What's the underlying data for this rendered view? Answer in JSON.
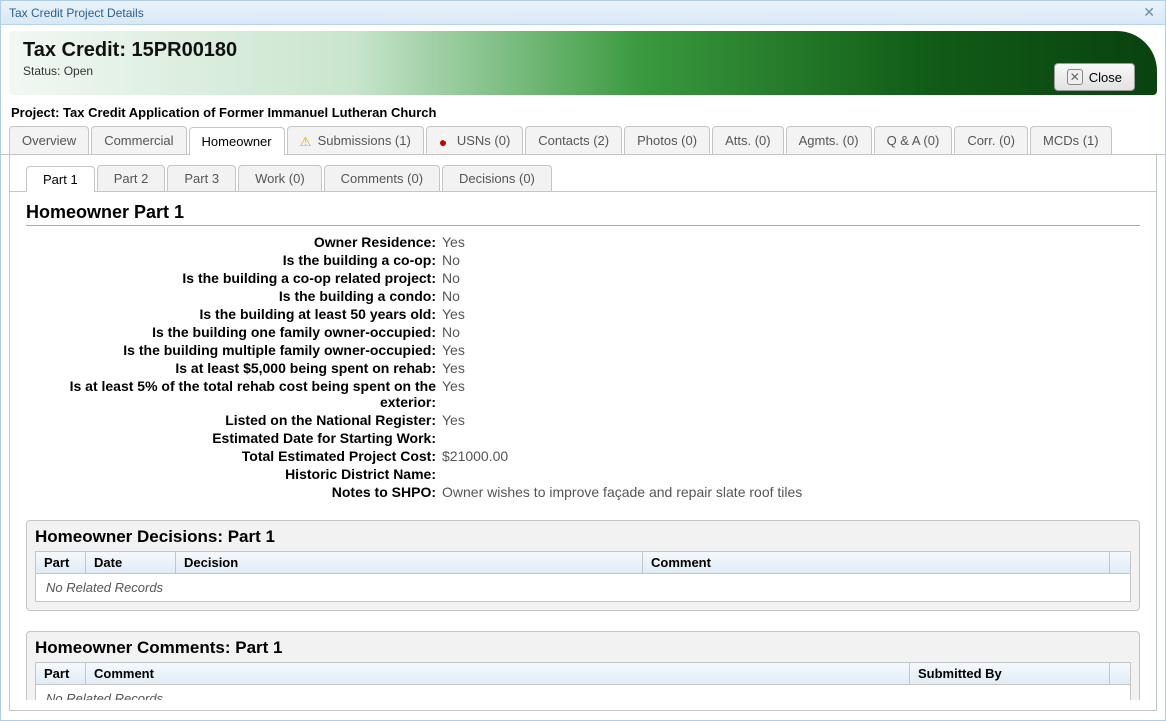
{
  "window": {
    "title": "Tax Credit Project Details"
  },
  "header": {
    "title": "Tax Credit: 15PR00180",
    "status_label": "Status:",
    "status_value": "Open",
    "close_label": "Close"
  },
  "project": {
    "label": "Project:",
    "name": "Tax Credit Application of Former Immanuel Lutheran Church"
  },
  "tabs": [
    {
      "label": "Overview"
    },
    {
      "label": "Commercial"
    },
    {
      "label": "Homeowner",
      "active": true
    },
    {
      "label": "Submissions (1)",
      "icon": "warn"
    },
    {
      "label": "USNs (0)",
      "icon": "error"
    },
    {
      "label": "Contacts (2)"
    },
    {
      "label": "Photos (0)"
    },
    {
      "label": "Atts. (0)"
    },
    {
      "label": "Agmts. (0)"
    },
    {
      "label": "Q & A (0)"
    },
    {
      "label": "Corr. (0)"
    },
    {
      "label": "MCDs (1)"
    }
  ],
  "subtabs": [
    {
      "label": "Part 1",
      "active": true
    },
    {
      "label": "Part 2"
    },
    {
      "label": "Part 3"
    },
    {
      "label": "Work (0)"
    },
    {
      "label": "Comments (0)"
    },
    {
      "label": "Decisions (0)"
    }
  ],
  "part1": {
    "title": "Homeowner Part 1",
    "fields": [
      {
        "label": "Owner Residence:",
        "value": "Yes"
      },
      {
        "label": "Is the building a co-op:",
        "value": "No"
      },
      {
        "label": "Is the building a co-op related project:",
        "value": "No"
      },
      {
        "label": "Is the building a condo:",
        "value": "No"
      },
      {
        "label": "Is the building at least 50 years old:",
        "value": "Yes"
      },
      {
        "label": "Is the building one family owner-occupied:",
        "value": "No"
      },
      {
        "label": "Is the building multiple family owner-occupied:",
        "value": "Yes"
      },
      {
        "label": "Is at least $5,000 being spent on rehab:",
        "value": "Yes"
      },
      {
        "label": "Is at least 5% of the total rehab cost being spent on the exterior:",
        "value": "Yes"
      },
      {
        "label": "Listed on the National Register:",
        "value": "Yes"
      },
      {
        "label": "Estimated Date for Starting Work:",
        "value": ""
      },
      {
        "label": "Total Estimated Project Cost:",
        "value": "$21000.00"
      },
      {
        "label": "Historic District Name:",
        "value": ""
      },
      {
        "label": "Notes to SHPO:",
        "value": "Owner wishes to improve façade and repair slate roof tiles"
      }
    ]
  },
  "decisions_panel": {
    "title": "Homeowner Decisions: Part 1",
    "columns": [
      "Part",
      "Date",
      "Decision",
      "Comment"
    ],
    "empty": "No Related Records"
  },
  "comments_panel": {
    "title": "Homeowner Comments: Part 1",
    "columns": [
      "Part",
      "Comment",
      "Submitted By"
    ],
    "empty": "No Related Records"
  }
}
